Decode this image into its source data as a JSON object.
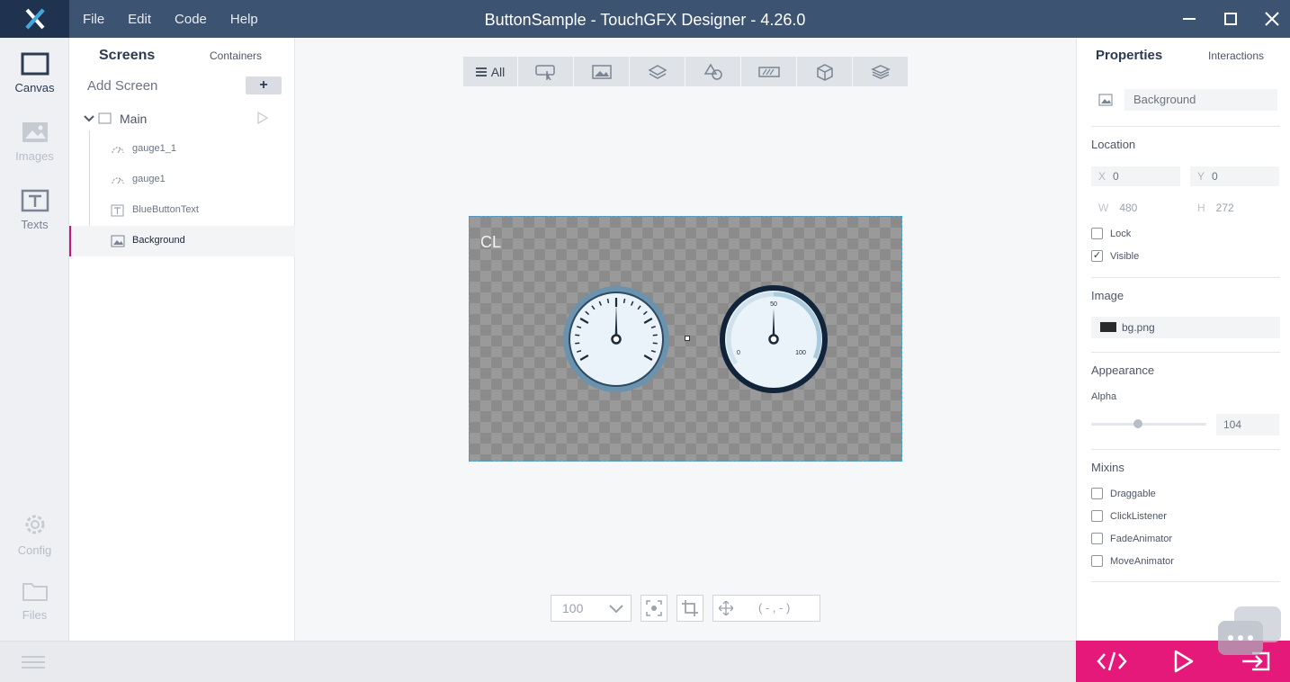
{
  "app": {
    "title": "ButtonSample - TouchGFX Designer - 4.26.0",
    "menu": [
      "File",
      "Edit",
      "Code",
      "Help"
    ],
    "accent": "#e4197a",
    "titlebar_color": "#3d5372"
  },
  "nav": {
    "items": [
      {
        "label": "Canvas",
        "icon": "canvas-icon",
        "active": true
      },
      {
        "label": "Images",
        "icon": "images-icon",
        "active": false
      },
      {
        "label": "Texts",
        "icon": "texts-icon",
        "active": false
      },
      {
        "label": "Config",
        "icon": "gear-icon",
        "active": false
      },
      {
        "label": "Files",
        "icon": "folder-icon",
        "active": false
      }
    ]
  },
  "tree": {
    "tab_screens": "Screens",
    "tab_containers": "Containers",
    "add_screen": "Add Screen",
    "add_button": "+",
    "screen_name": "Main",
    "widgets": [
      {
        "label": "gauge1_1",
        "icon": "gauge-icon",
        "selected": false
      },
      {
        "label": "gauge1",
        "icon": "gauge-icon",
        "selected": false
      },
      {
        "label": "BlueButtonText",
        "icon": "text-icon",
        "selected": false
      },
      {
        "label": "Background",
        "icon": "image-icon",
        "selected": true
      }
    ]
  },
  "canvas": {
    "toolbar_all": "All",
    "toolbar_icons": [
      "button-icon",
      "image-icon",
      "layers-icon",
      "shapes-icon",
      "progress-icon",
      "cube-icon",
      "stack-icon"
    ],
    "screen_label": "CL",
    "zoom": "100",
    "coords": "( - , - )"
  },
  "properties": {
    "tab_properties": "Properties",
    "tab_interactions": "Interactions",
    "widget_name": "Background",
    "location_label": "Location",
    "x_key": "X",
    "x": "0",
    "y_key": "Y",
    "y": "0",
    "w_key": "W",
    "w": "480",
    "h_key": "H",
    "h": "272",
    "lock_label": "Lock",
    "lock": false,
    "visible_label": "Visible",
    "visible": true,
    "image_label": "Image",
    "image_value": "bg.png",
    "appearance_label": "Appearance",
    "alpha_label": "Alpha",
    "alpha": "104",
    "alpha_fraction": 0.41,
    "mixins_label": "Mixins",
    "mixins": [
      {
        "label": "Draggable",
        "checked": false
      },
      {
        "label": "ClickListener",
        "checked": false
      },
      {
        "label": "FadeAnimator",
        "checked": false
      },
      {
        "label": "MoveAnimator",
        "checked": false
      }
    ]
  },
  "gauges": {
    "right_min": "0",
    "right_mid": "50",
    "right_max": "100"
  }
}
